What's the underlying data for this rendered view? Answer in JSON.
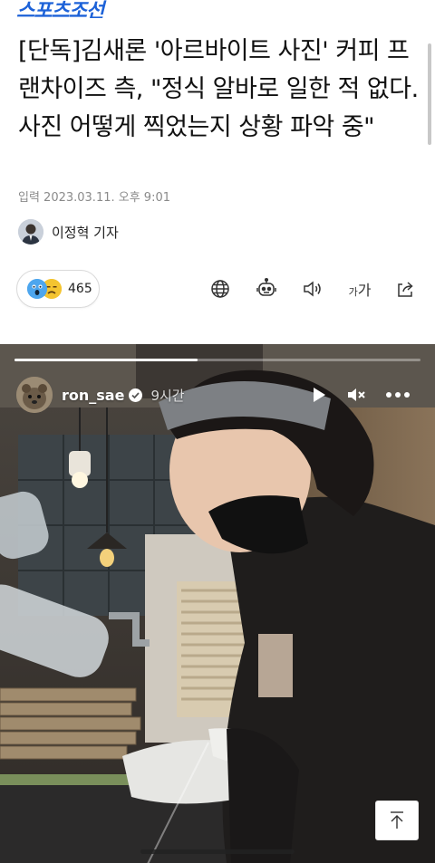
{
  "header": {
    "brand": "스포츠조선"
  },
  "article": {
    "headline": "[단독]김새론 '아르바이트 사진' 커피 프랜차이즈 측, \"정식 알바로 일한 적 없다. 사진 어떻게 찍었는지 상황 파악 중\"",
    "date": "입력 2023.03.11. 오후 9:01",
    "reporter": "이정혁 기자"
  },
  "toolbar": {
    "reaction_count": "465",
    "reaction_icons": [
      "shocked-face-icon",
      "sad-face-icon"
    ],
    "font_size_label_small": "가",
    "font_size_label_large": "가",
    "icons": [
      "globe-icon",
      "robot-icon",
      "speaker-icon",
      "font-size-icon",
      "share-icon"
    ]
  },
  "story": {
    "username": "ron_sae",
    "time": "9시간",
    "progress": 0.45,
    "icons": [
      "play-icon",
      "mute-icon",
      "more-icon"
    ]
  },
  "colors": {
    "brand": "#1d62d8",
    "text": "#111111",
    "meta": "#8a8a8a"
  }
}
